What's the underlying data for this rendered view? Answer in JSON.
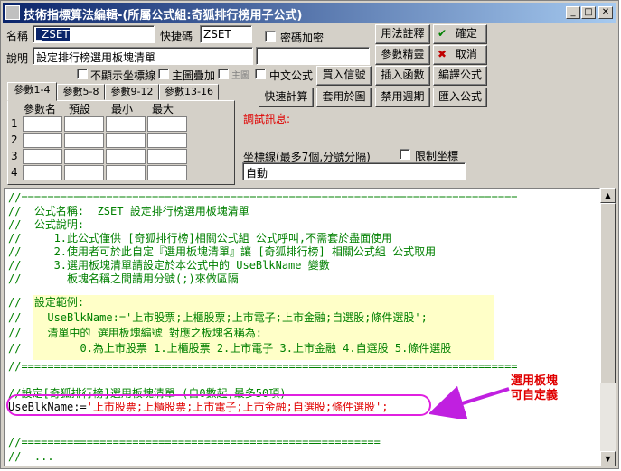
{
  "window": {
    "title": "技術指標算法編輯-(所屬公式組:奇狐排行榜用子公式)",
    "minimize": "_",
    "maximize": "□",
    "close": "✕"
  },
  "form": {
    "name_label": "名稱",
    "name_value": "_ZSET",
    "shortcut_label": "快捷碼",
    "shortcut_value": "ZSET",
    "password_label": "密碼加密",
    "desc_label": "說明",
    "desc_value": "設定排行榜選用板塊清單",
    "hide_axis_label": "不顯示坐標線",
    "main_overlay_label": "主圖疊加",
    "main_disabled_label": "主圖",
    "chinese_formula_label": "中文公式"
  },
  "buttons": {
    "usage_notes": "用法註釋",
    "confirm": "確定",
    "cancel": "取消",
    "param_wizard": "參數精靈",
    "buy_sell_signal": "買入信號",
    "insert_function": "插入函數",
    "compile_formula": "編譯公式",
    "quick_calc": "快速計算",
    "apply_to_chart": "套用於圖",
    "disable_period": "禁用週期",
    "import_formula": "匯入公式"
  },
  "tabs": [
    "參數1-4",
    "參數5-8",
    "參數9-12",
    "參數13-16"
  ],
  "param_table": {
    "headers": [
      "參數名",
      "預設",
      "最小",
      "最大"
    ],
    "rows": [
      "1",
      "2",
      "3",
      "4"
    ]
  },
  "debug_label": "調試訊息:",
  "axis": {
    "label": "坐標線(最多7個,分號分隔)",
    "limit_label": "限制坐標",
    "value": "自動"
  },
  "code": {
    "l1": "//============================================================================",
    "l2": "//  公式名稱: _ZSET 設定排行榜選用板塊清單",
    "l3": "//  公式說明:",
    "l4": "//     1.此公式僅供 [奇狐排行榜]相關公式組 公式呼叫,不需套於盡面使用",
    "l5": "//     2.使用者可於此自定『選用板塊清單』讓 [奇狐排行榜] 相關公式組 公式取用",
    "l6": "//     3.選用板塊清單請設定於本公式中的 UseBlkName 變數",
    "l7": "//       板塊名稱之間請用分號(;)來做區隔",
    "l8": "//  設定範例:",
    "l9a": "//    UseBlkName:=",
    "l9b": "'上市股票;上櫃股票;上市電子;上市金融;自選股;條件選股';",
    "l10": "//    清單中的 選用板塊編號 對應之板塊名稱為:",
    "l11": "//         0.為上市股票 1.上櫃股票 2.上市電子 3.上市金融 4.自選股 5.條件選股",
    "l12": "//============================================================================",
    "l13": "//設定[奇狐排行榜]選用板塊清單 (自0數起,最多50項)",
    "l14a": "UseBlkName:=",
    "l14b": "'上市股票;上櫃股票;上市電子;上市金融;自選股;條件選股';",
    "l15": "//=======================================================",
    "l16": "//  ..."
  },
  "annotation": {
    "line1": "選用板塊",
    "line2": "可自定義",
    "color": "#e00000"
  }
}
